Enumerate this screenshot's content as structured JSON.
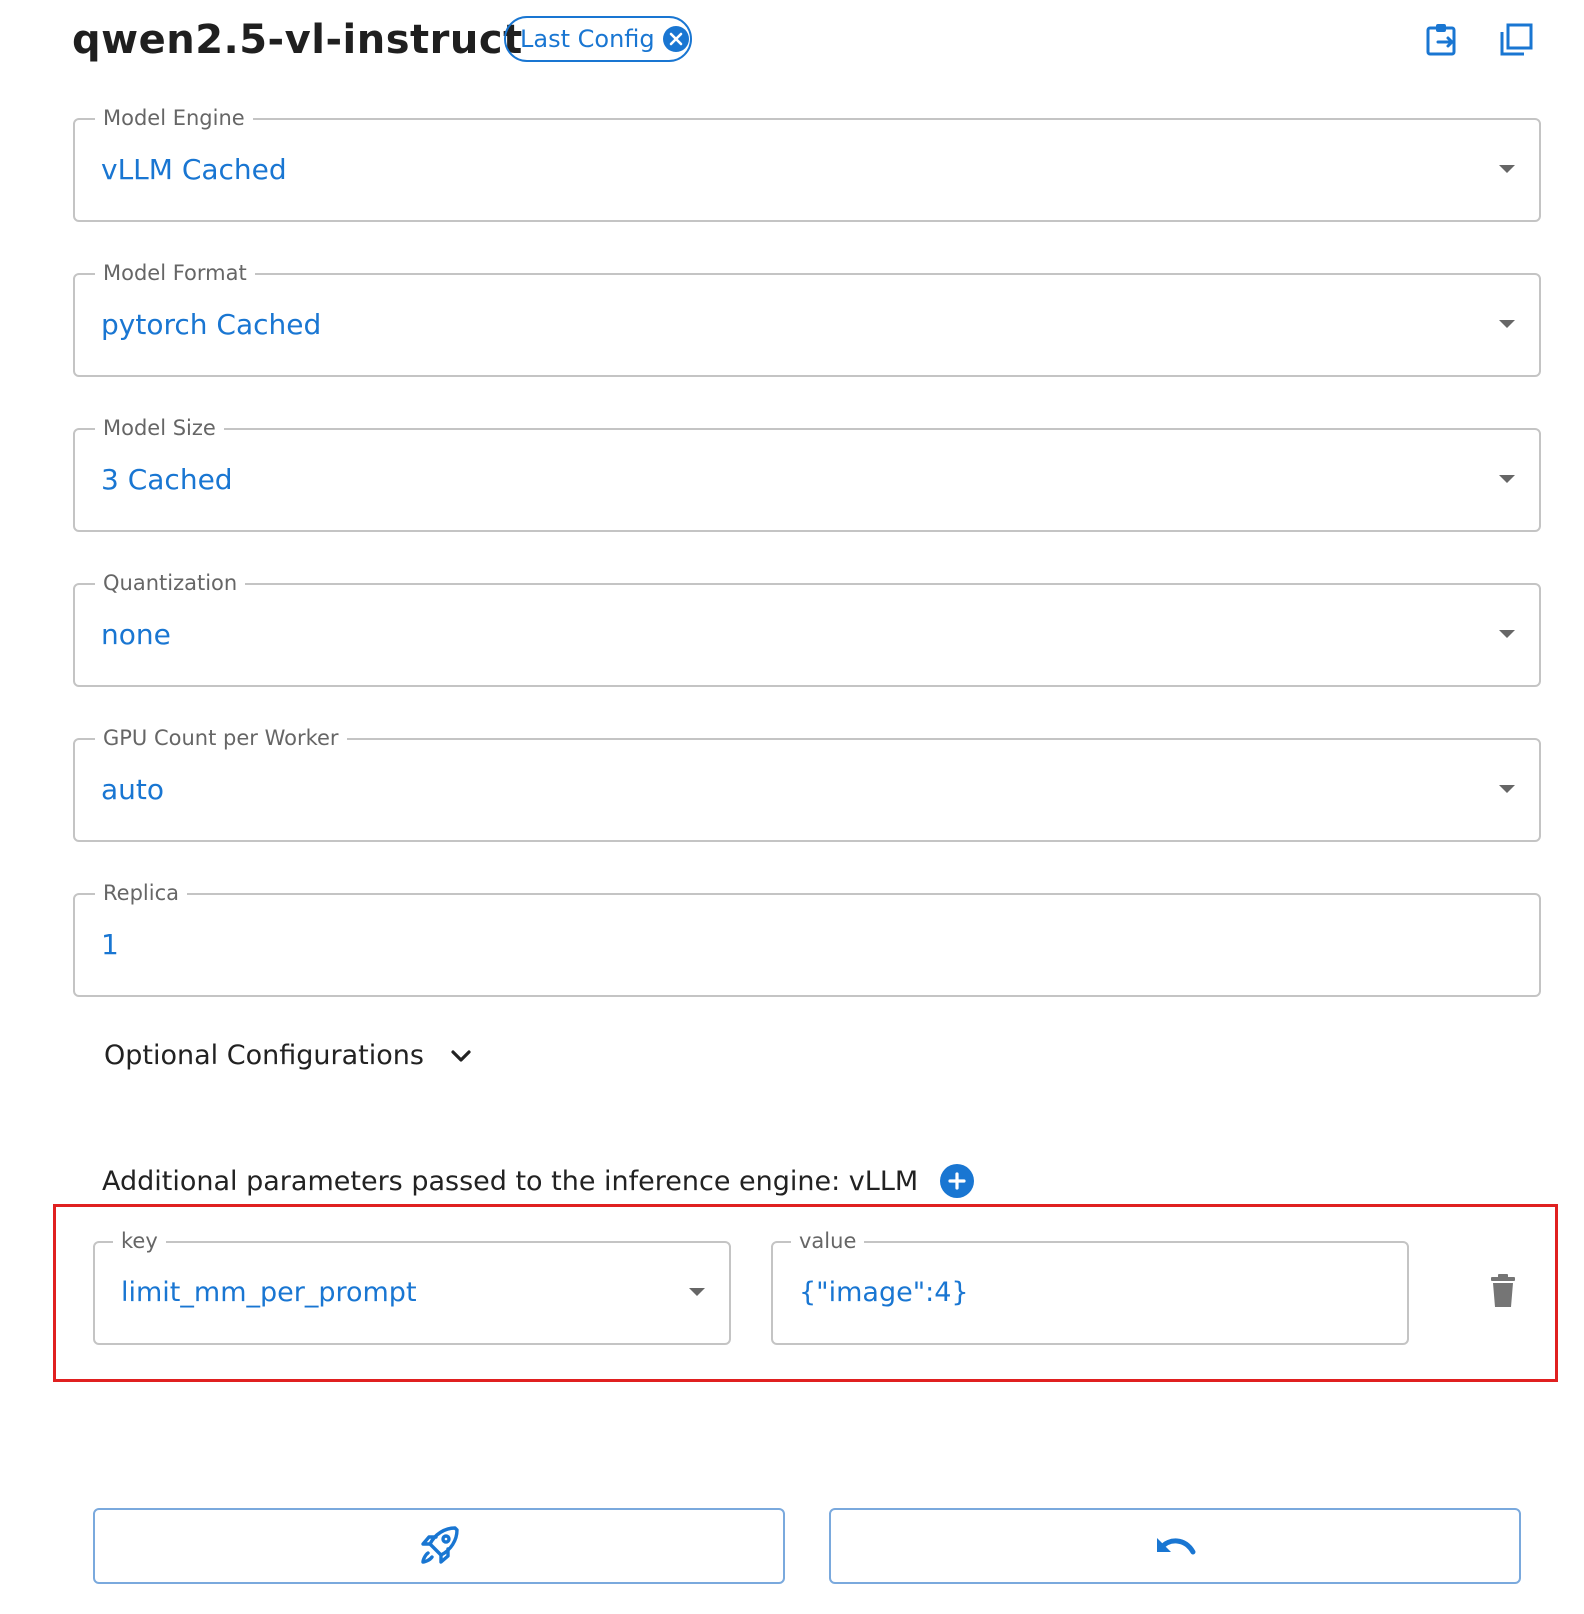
{
  "header": {
    "title": "qwen2.5-vl-instruct",
    "chip_label": "Last Config",
    "icons": [
      "chip-close-icon",
      "clipboard-transfer-icon",
      "copy-icon"
    ]
  },
  "fields": [
    {
      "label": "Model Engine",
      "value": "vLLM Cached",
      "type": "select"
    },
    {
      "label": "Model Format",
      "value": "pytorch Cached",
      "type": "select"
    },
    {
      "label": "Model Size",
      "value": "3 Cached",
      "type": "select"
    },
    {
      "label": "Quantization",
      "value": "none",
      "type": "select"
    },
    {
      "label": "GPU Count per Worker",
      "value": "auto",
      "type": "select"
    },
    {
      "label": "Replica",
      "value": "1",
      "type": "input"
    }
  ],
  "optional": {
    "label": "Optional Configurations",
    "icon": "chevron-down-icon"
  },
  "additional": {
    "label": "Additional parameters passed to the inference engine: vLLM",
    "add_icon": "plus-circle-icon",
    "params": [
      {
        "key_label": "key",
        "key_value": "limit_mm_per_prompt",
        "value_label": "value",
        "value_value": "{\"image\":4}"
      }
    ],
    "delete_icon": "trash-icon"
  },
  "actions": {
    "launch_icon": "rocket-icon",
    "reset_icon": "undo-icon"
  },
  "colors": {
    "accent": "#1976d2",
    "highlight": "#e02020",
    "border": "#c4c4c4"
  }
}
